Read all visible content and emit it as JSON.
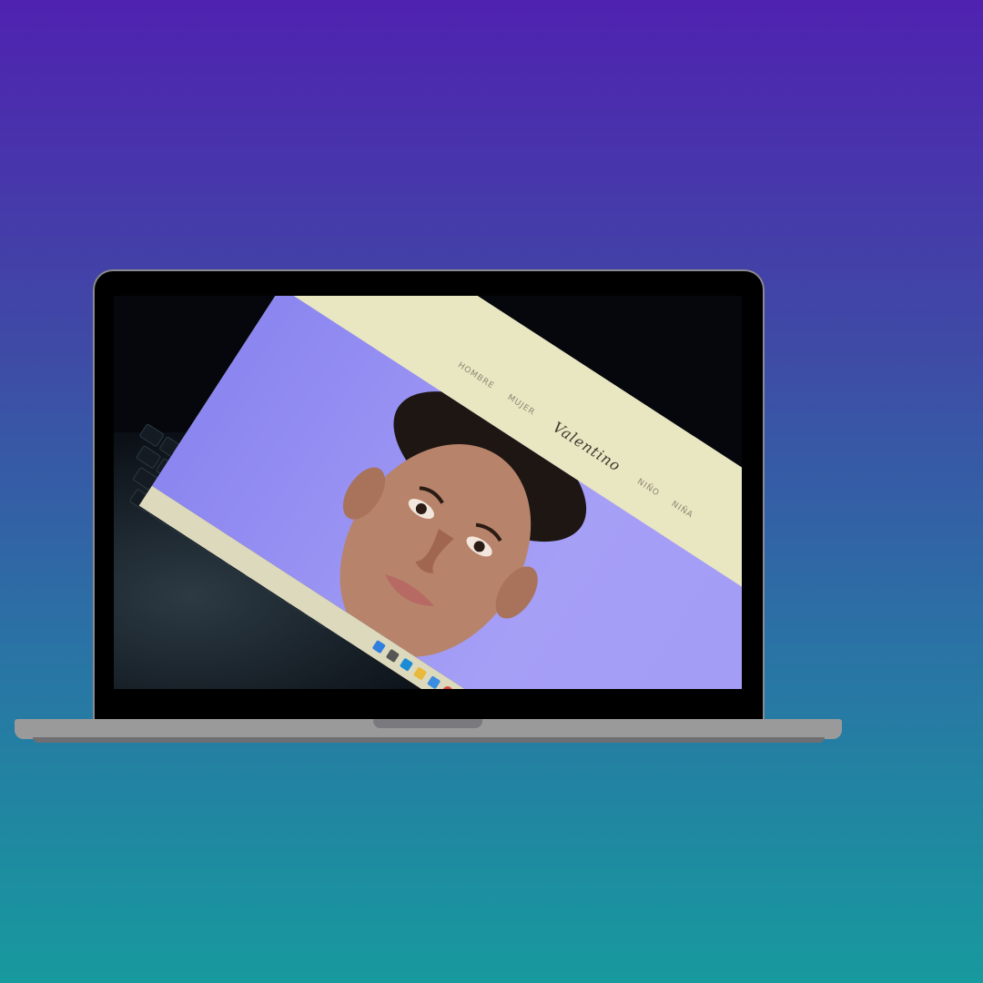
{
  "website": {
    "nav_left": [
      "HOMBRE",
      "MUJER"
    ],
    "brand": "Valentino",
    "nav_right": [
      "NIÑO",
      "NIÑA"
    ]
  },
  "colors": {
    "bg_top": "#4f22b0",
    "bg_bottom": "#179a9e",
    "site_frame": "#e9e6c2",
    "hero": "#8b86f0"
  },
  "taskbar_icons": [
    "start-icon",
    "search-icon",
    "edge-icon",
    "file-explorer-icon",
    "store-icon",
    "chrome-icon",
    "app-icon"
  ]
}
